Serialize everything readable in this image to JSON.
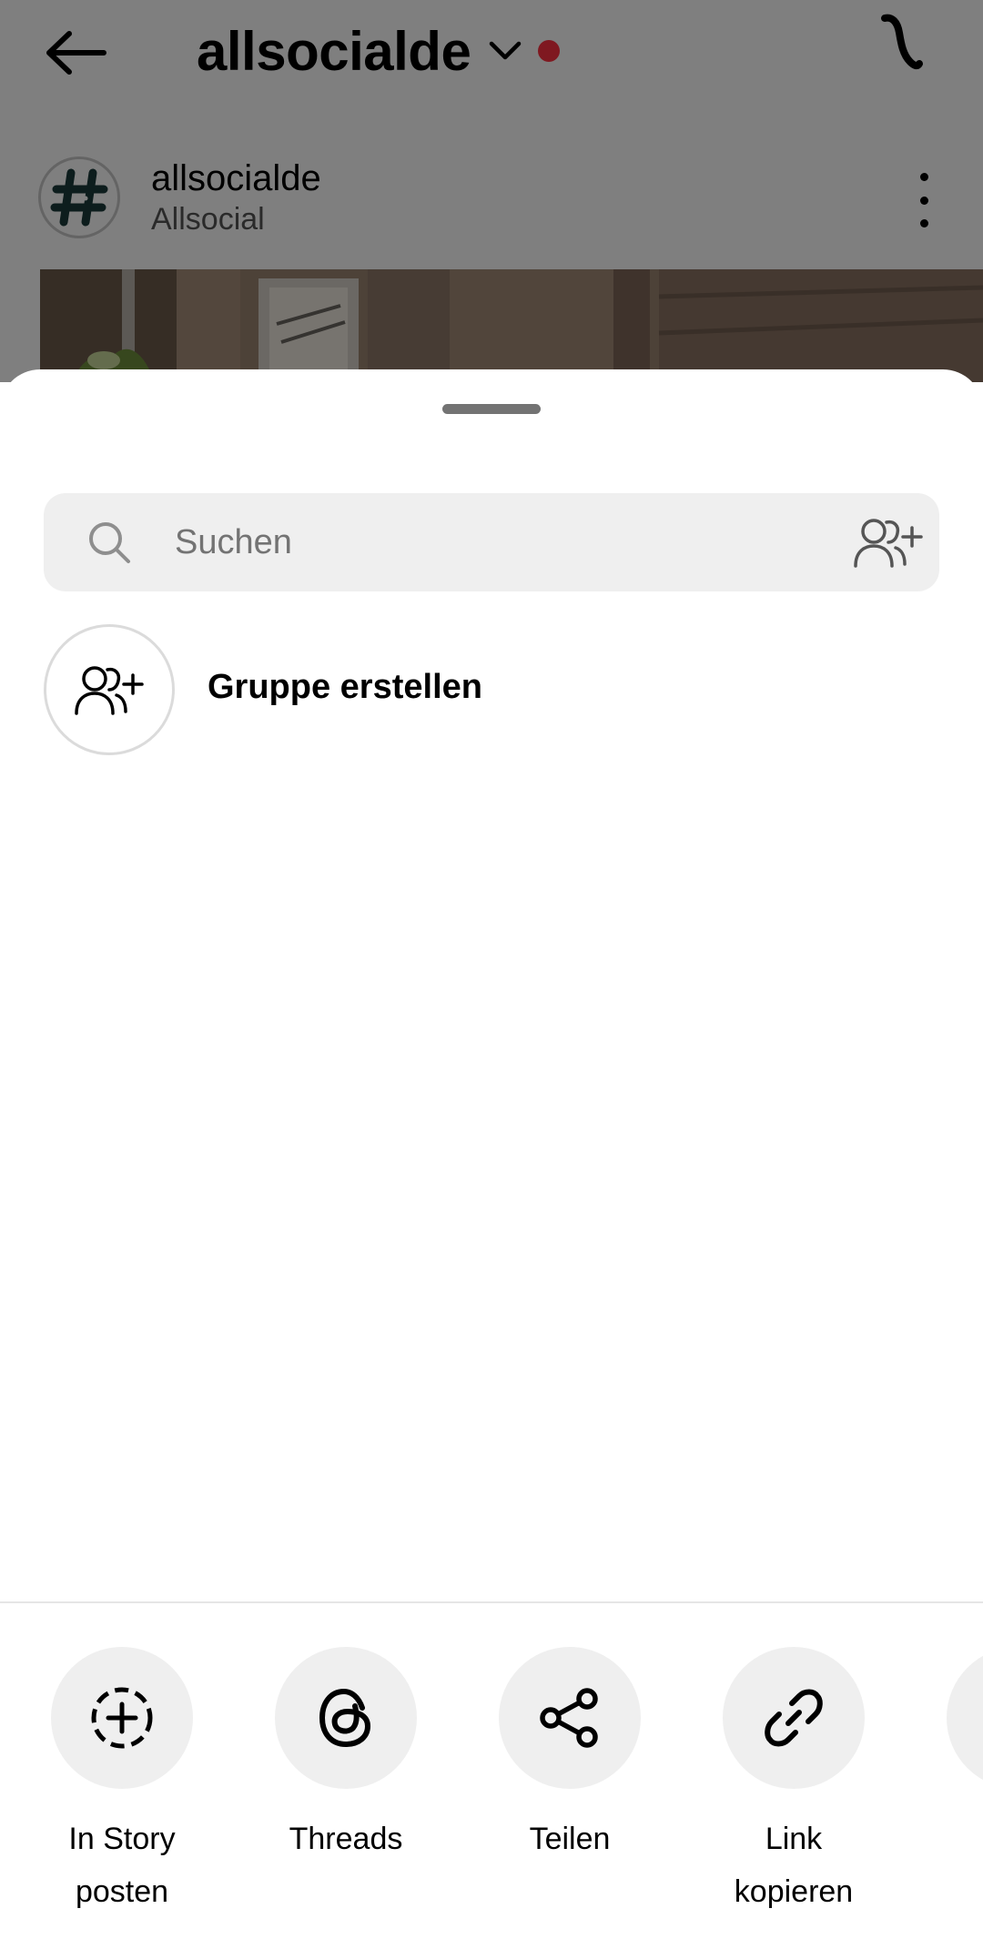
{
  "header": {
    "title": "allsocialde",
    "back_icon": "arrow-left-icon",
    "chevron_icon": "chevron-down-icon",
    "live_dot_color": "#ff3040"
  },
  "post": {
    "username": "allsocialde",
    "subtitle": "Allsocial",
    "avatar_icon": "hashtag-icon",
    "more_icon": "more-vertical-icon"
  },
  "share_sheet": {
    "search": {
      "placeholder": "Suchen",
      "value": ""
    },
    "create_group": {
      "label": "Gruppe erstellen"
    },
    "actions": [
      {
        "label": "In Story posten",
        "icon": "add-to-story-icon"
      },
      {
        "label": "Threads",
        "icon": "threads-icon"
      },
      {
        "label": "Teilen",
        "icon": "share-icon"
      },
      {
        "label": "Link kopieren",
        "icon": "link-icon"
      }
    ]
  }
}
